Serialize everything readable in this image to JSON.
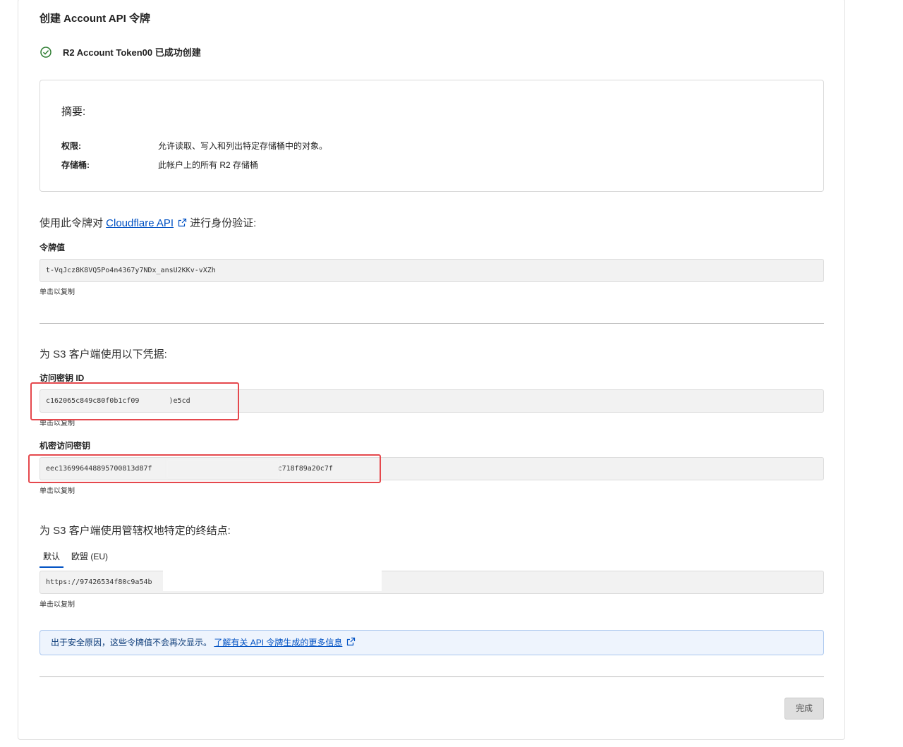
{
  "page": {
    "title": "创建 Account API 令牌",
    "success_message": "R2 Account Token00 已成功创建"
  },
  "summary": {
    "heading": "摘要:",
    "permissions_label": "权限:",
    "permissions_value": "允许读取、写入和列出特定存储桶中的对象。",
    "buckets_label": "存储桶:",
    "buckets_value": "此帐户上的所有 R2 存储桶"
  },
  "api_section": {
    "prefix": "使用此令牌对 ",
    "link_text": "Cloudflare API",
    "suffix": "进行身份验证:",
    "token_label": "令牌值",
    "token_value": "t-VqJcz8K8VQ5Po4n4367y7NDx_ansU2KKv-vXZh",
    "copy_hint": "单击以复制"
  },
  "s3_section": {
    "heading": "为 S3 客户端使用以下凭据:",
    "access_key_label": "访问密钥 ID",
    "access_key_visible_start": "c162065c849c80f0b1cf09",
    "access_key_visible_end": ")e5cd",
    "secret_key_label": "机密访问密钥",
    "secret_key_visible_start": "eec136996448895700813d87f",
    "secret_key_visible_end": "!c718f89a20c7f",
    "copy_hint": "单击以复制"
  },
  "endpoint_section": {
    "heading": "为 S3 客户端使用管辖权地特定的终结点:",
    "tabs": [
      {
        "label": "默认",
        "active": true
      },
      {
        "label": "欧盟 (EU)",
        "active": false
      }
    ],
    "endpoint_visible": "https://97426534f80c9a54b",
    "copy_hint": "单击以复制"
  },
  "notice": {
    "text": "出于安全原因，这些令牌值不会再次显示。",
    "link_text": "了解有关 API 令牌生成的更多信息"
  },
  "footer": {
    "done_label": "完成"
  },
  "colors": {
    "link": "#0051c3",
    "success": "#2e7d32",
    "highlight": "#e5484d",
    "notice_bg": "#eef4fd"
  }
}
